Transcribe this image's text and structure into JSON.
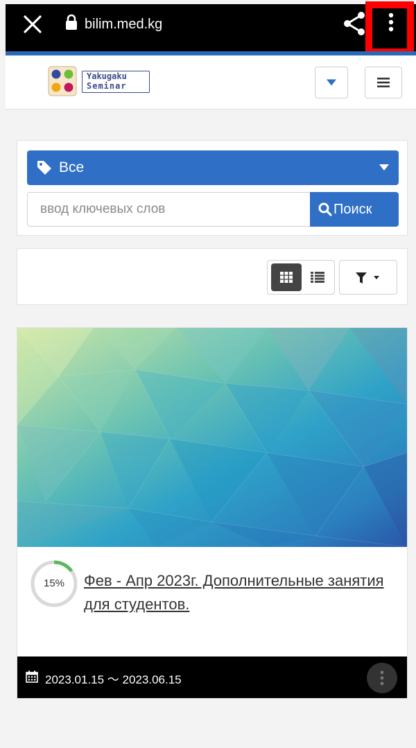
{
  "browser": {
    "url": "bilim.med.kg",
    "close_icon": "close-icon",
    "lock_icon": "lock-icon",
    "share_icon": "share-icon",
    "menu_icon": "more-vertical-icon"
  },
  "header": {
    "logo": {
      "line1": "Yakugaku",
      "line2": "Seminar"
    },
    "dropdown_icon": "caret-down-icon",
    "menu_icon": "hamburger-icon",
    "accent": "#2a6ab6"
  },
  "search": {
    "category_label": "Все",
    "category_icon": "tag-icon",
    "placeholder": "ввод ключевых слов",
    "value": "",
    "button_label": "Поиск",
    "button_icon": "search-icon",
    "accent": "#2f6fc6"
  },
  "toolbar": {
    "grid_view_icon": "grid-view-icon",
    "list_view_icon": "list-view-icon",
    "filter_icon": "filter-icon",
    "active_view": "grid"
  },
  "courses": [
    {
      "progress_percent": 15,
      "progress_label": "15%",
      "title": "Фев - Апр 2023г. Дополнительные занятия для студентов.",
      "dates": "2023.01.15 ～ 2023.06.15",
      "calendar_icon": "calendar-icon",
      "more_icon": "more-vertical-icon"
    }
  ],
  "highlight_color": "#ff0000"
}
